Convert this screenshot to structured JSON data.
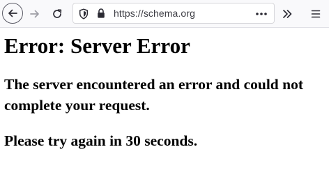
{
  "browser": {
    "url": "https://schema.org",
    "icons": {
      "back": "arrow-left-icon",
      "forward": "arrow-right-icon",
      "reload": "reload-icon",
      "shield": "tracking-shield-icon",
      "lock": "lock-icon",
      "page_actions": "more-horizontal-icon",
      "overflow": "double-chevron-right-icon",
      "menu": "hamburger-menu-icon"
    }
  },
  "page": {
    "heading": "Error: Server Error",
    "message": "The server encountered an error and could not complete your request.",
    "retry_message": "Please try again in 30 seconds."
  }
}
